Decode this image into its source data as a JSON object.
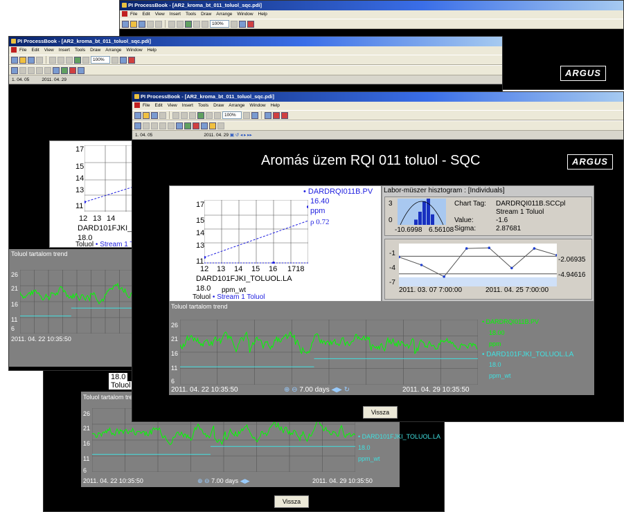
{
  "windows": {
    "back": {
      "title": "PI ProcessBook - [AR2_kroma_bt_011_toluol_sqc.pdi]"
    },
    "mid": {
      "title": "PI ProcessBook - [AR2_kroma_bt_011_toluol_sqc.pdi]",
      "nav_date1": "1. 04. 05",
      "nav_date2": "2011. 04. 29"
    },
    "front": {
      "title": "PI ProcessBook - [AR2_kroma_bt_011_toluol_sqc.pdi]",
      "nav_date1": "1. 04. 05",
      "nav_date2": "2011. 04. 29"
    }
  },
  "menu": [
    "File",
    "Edit",
    "View",
    "Insert",
    "Tools",
    "Draw",
    "Arrange",
    "Window",
    "Help"
  ],
  "toolbar": {
    "zoom": "100%"
  },
  "display": {
    "title": "Aromás üzem RQI 011 toluol - SQC",
    "logo": "ARGUS",
    "button": "Vissza"
  },
  "xy": {
    "yticks": [
      "17",
      "15",
      "14",
      "13",
      "11"
    ],
    "xticks": [
      "12",
      "13",
      "14",
      "15",
      "16",
      "1718"
    ],
    "tag": "DARD101FJKI_TOLUOL.LA",
    "value": "18.0",
    "units": "ppm_wt",
    "leg1": "Toluol",
    "leg2": "• Stream 1 Toluol",
    "side_tag": "• DARDRQI011B.PV",
    "side_val": "16.40",
    "side_unit": "ppm",
    "side_rho": "ρ 0.72"
  },
  "histo": {
    "header": "Labor-müszer hisztogram : [Individuals]",
    "y_max": "3",
    "y_min": "0",
    "x_min": "-10.6998",
    "x_max": "6.56108",
    "chart_tag_label": "Chart Tag:",
    "chart_tag": "DARDRQI011B.SCCpl",
    "stream": "Stream 1 Toluol",
    "value_label": "Value:",
    "value": "-1.6",
    "sigma_label": "Sigma:",
    "sigma": "2.87681",
    "bars": [
      0.2,
      0.5,
      0.9,
      1.0,
      0.4
    ]
  },
  "individuals": {
    "yticks": [
      "-1",
      "-4",
      "-7"
    ],
    "x_start": "2011. 03. 07 7:00:00",
    "x_end": "2011. 04. 25 7:00:00",
    "ref1": "-2.06935",
    "ref2": "-4.94616",
    "points": [
      -2.2,
      -3.5,
      -5.4,
      -0.8,
      -0.7,
      -4.0,
      -0.8,
      -1.9
    ]
  },
  "trend": {
    "title": "Toluol tartalom trend",
    "yticks": [
      "26",
      "21",
      "16",
      "11",
      "6"
    ],
    "t_start": "2011. 04. 22 10:35:50",
    "t_end": "2011. 04. 29 10:35:50",
    "span": "7.00 days",
    "s1_tag": "• DARDRQI011B.PV",
    "s1_val": "18.00",
    "s1_unit": "ppm",
    "s2_tag": "• DARD101FJKI_TOLUOL.LA",
    "s2_val": "18.0",
    "s2_unit": "ppm_wt",
    "ref_level": 14,
    "s2_level": 11.5
  },
  "colors": {
    "trend_green": "#00ff00",
    "trend_cyan": "#40e0e0",
    "xy_blue": "#2020e0",
    "panel_gray": "#808080"
  }
}
